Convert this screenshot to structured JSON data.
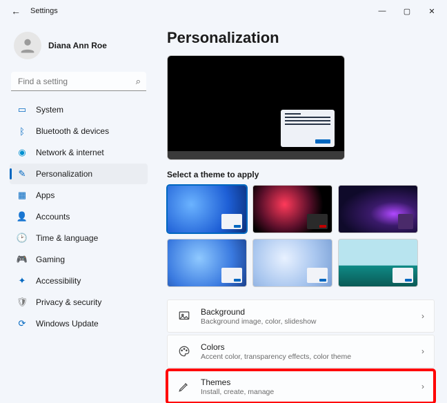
{
  "app": {
    "name": "Settings"
  },
  "user": {
    "name": "Diana Ann Roe"
  },
  "search": {
    "placeholder": "Find a setting"
  },
  "nav": [
    {
      "label": "System"
    },
    {
      "label": "Bluetooth & devices"
    },
    {
      "label": "Network & internet"
    },
    {
      "label": "Personalization"
    },
    {
      "label": "Apps"
    },
    {
      "label": "Accounts"
    },
    {
      "label": "Time & language"
    },
    {
      "label": "Gaming"
    },
    {
      "label": "Accessibility"
    },
    {
      "label": "Privacy & security"
    },
    {
      "label": "Windows Update"
    }
  ],
  "page": {
    "title": "Personalization",
    "theme_section_label": "Select a theme to apply"
  },
  "options": [
    {
      "title": "Background",
      "sub": "Background image, color, slideshow"
    },
    {
      "title": "Colors",
      "sub": "Accent color, transparency effects, color theme"
    },
    {
      "title": "Themes",
      "sub": "Install, create, manage"
    }
  ]
}
